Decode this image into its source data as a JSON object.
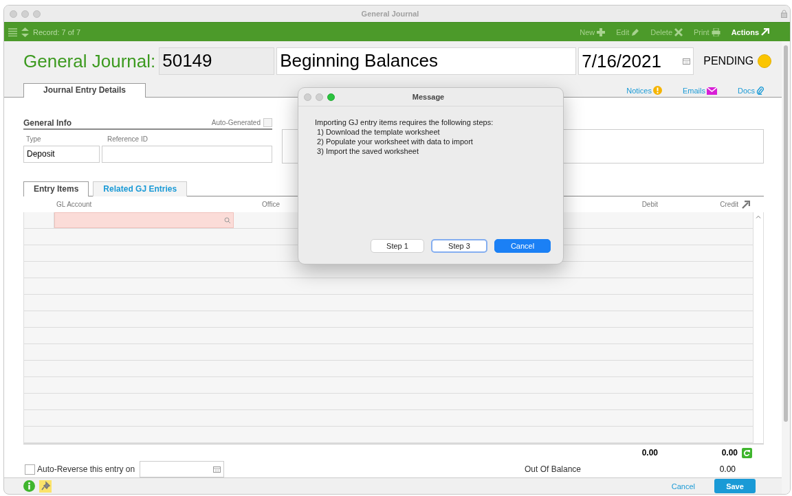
{
  "window": {
    "title": "General Journal"
  },
  "toolbar": {
    "record": "Record: 7 of 7",
    "actions": [
      {
        "label": "New",
        "disabled": true
      },
      {
        "label": "Edit",
        "disabled": true
      },
      {
        "label": "Delete",
        "disabled": true
      },
      {
        "label": "Print",
        "disabled": true
      },
      {
        "label": "Actions",
        "disabled": false
      }
    ]
  },
  "header": {
    "title": "General Journal:",
    "number": "50149",
    "description": "Beginning Balances",
    "date": "7/16/2021",
    "status": "PENDING"
  },
  "tabs": [
    {
      "label": "Journal Entry Details",
      "selected": true
    }
  ],
  "links": [
    {
      "label": "Notices"
    },
    {
      "label": "Emails"
    },
    {
      "label": "Docs"
    }
  ],
  "general_info": {
    "heading": "General Info",
    "auto_generated": {
      "label": "Auto-Generated",
      "checked": false
    },
    "type": {
      "label": "Type",
      "value": "Deposit"
    },
    "reference_id": {
      "label": "Reference ID"
    }
  },
  "entry_tabs": [
    {
      "label": "Entry Items",
      "selected": true
    },
    {
      "label": "Related GJ Entries",
      "selected": false
    }
  ],
  "table": {
    "columns": [
      "GL Account",
      "Office",
      "Debit",
      "Credit"
    ],
    "gl_account_invalid": true
  },
  "totals": {
    "debit": "0.00",
    "credit": "0.00",
    "balance_label": "Out Of Balance",
    "balance": "0.00"
  },
  "auto_reverse": {
    "label": "Auto-Reverse this entry on",
    "checked": false
  },
  "footer": {
    "cancel": "Cancel",
    "save": "Save"
  },
  "dialog": {
    "title": "Message",
    "lines": [
      "Importing GJ entry items requires the following steps:",
      " 1) Download the template worksheet",
      " 2) Populate your worksheet with data to import",
      " 3) Import the saved worksheet"
    ],
    "buttons": [
      {
        "label": "Step 1",
        "kind": "normal"
      },
      {
        "label": "Step 3",
        "kind": "focused"
      },
      {
        "label": "Cancel",
        "kind": "default"
      }
    ]
  }
}
